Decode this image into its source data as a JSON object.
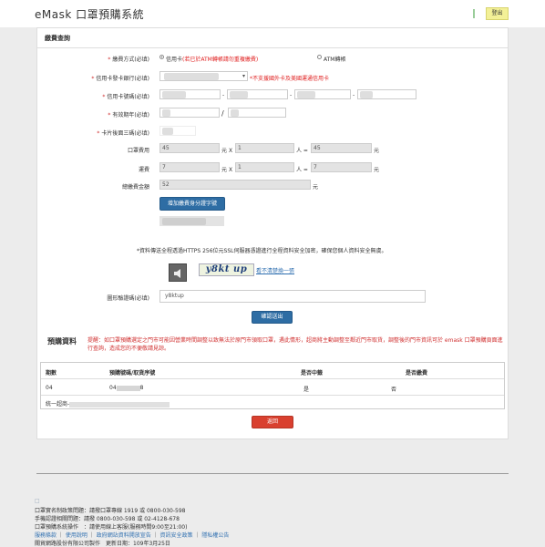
{
  "header": {
    "app_title": "eMask 口罩預購系統",
    "logout_label": "登出"
  },
  "panel": {
    "title": "繳費查詢"
  },
  "form": {
    "payment_method_label": "繳費方式(必填)",
    "option_credit_card": "信用卡",
    "option_credit_card_note": "(若已於ATM轉帳請勿重複繳費)",
    "option_atm": "ATM轉帳",
    "bank_label": "信用卡發卡銀行(必填)",
    "bank_note": "*不支援國外卡及美國運通信用卡",
    "card_number_label": "信用卡號碼(必填)",
    "expiry_label": "有效期年(必填)",
    "expiry_sep": "/",
    "cvv_label": "卡片後面三碼(必填)",
    "mask_fee_label": "口罩費用",
    "mask_price": "45",
    "mask_qty": "1",
    "mask_total": "45",
    "shipping_label": "運費",
    "shipping_price": "7",
    "shipping_qty": "1",
    "shipping_total": "7",
    "total_label": "總繳費金額",
    "grand_total": "52",
    "unit_yuan": "元",
    "unit_person": "人 =",
    "times": "X",
    "add_id_button": "增加繳費身分證字號",
    "secure_note": "*資料傳送全程透過HTTPS 256位元SSL伺服器憑證進行全程資料安全加密，確保您個人資料安全無虞。",
    "captcha_text": "y8kt up",
    "captcha_refresh": "看不清楚換一張",
    "captcha_label": "圖形驗證碼(必填)",
    "captcha_value": "y8ktup",
    "submit_button": "確認送出"
  },
  "preorder": {
    "title": "預購資料",
    "notice": "提醒：如口罩預購選定之門市可能因營業時間調整以致無法於原門市領取口罩，遇此情形，超商將主動調整至鄰近門市取貨，調整後的門市資訊可於 emask 口罩預購頁面進行查詢，造成您的不便敬請見諒。",
    "columns": [
      "期數",
      "預購號碼/取貨序號",
      "是否中籤",
      "是否繳費"
    ],
    "rows": [
      {
        "period": "04",
        "order_no": "04",
        "order_suffix": "8",
        "won": "是",
        "paid": "否"
      }
    ],
    "seven_code_label": "統一超商-"
  },
  "back_button": "返回",
  "footer": {
    "mask_hotline": "口罩實名制政策問題：請撥口罩專線 1919 或 0800-030-598",
    "phone_auth": "手機認證相關問題：請撥 0800-030-598 或 02-4128-678",
    "system_op": "口罩預購系統操作　：請使用線上客服(服務時間9:00至21:00)",
    "links": [
      "服務條款",
      "使用說明",
      "政府網站資料開放宣告",
      "資訊安全政策",
      "隱私權公告"
    ],
    "copyright": "關貿網路股份有限公司製作　更新日期：109年3月25日"
  }
}
